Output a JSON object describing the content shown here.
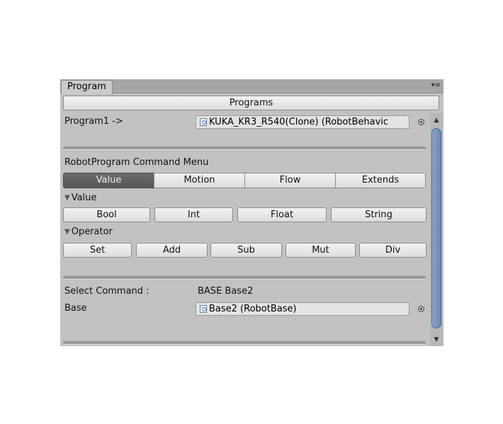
{
  "window": {
    "tab_label": "Program",
    "menu_icon": "kebab-menu-icon",
    "menu_glyph": "▾≡"
  },
  "programs_button": "Programs",
  "program_field": {
    "label": "Program1 ->",
    "value": "KUKA_KR3_R540(Clone) (RobotBehavic"
  },
  "command_menu": {
    "title": "RobotProgram Command Menu",
    "tabs": [
      "Value",
      "Motion",
      "Flow",
      "Extends"
    ],
    "active_tab": "Value"
  },
  "value_section": {
    "title": "Value",
    "buttons": [
      "Bool",
      "Int",
      "Float",
      "String"
    ]
  },
  "operator_section": {
    "title": "Operator",
    "buttons": [
      "Set",
      "Add",
      "Sub",
      "Mut",
      "Div"
    ]
  },
  "select_command": {
    "label": "Select Command :",
    "value": "BASE Base2"
  },
  "base_field": {
    "label": "Base",
    "value": "Base2 (RobotBase)"
  },
  "glyphs": {
    "triangle": "▼",
    "scroll_up": "▲",
    "scroll_down": "▼"
  },
  "colors": {
    "panel_bg": "#c2c2c2",
    "active_segment": "#5f5f5f",
    "scroll_thumb": "#7890bd"
  }
}
